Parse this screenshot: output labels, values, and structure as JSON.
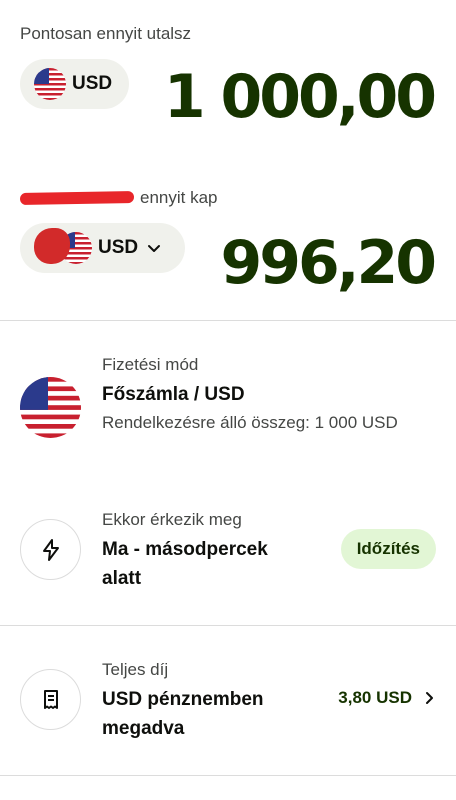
{
  "send": {
    "label": "Pontosan ennyit utalsz",
    "currency": "USD",
    "amount": "1 000,00"
  },
  "receive": {
    "label": "ennyit kap",
    "currency": "USD",
    "amount": "996,20"
  },
  "payment_method": {
    "caption": "Fizetési mód",
    "title": "Főszámla / USD",
    "subtitle": "Rendelkezésre álló összeg: 1 000 USD"
  },
  "arrival": {
    "caption": "Ekkor érkezik meg",
    "title": "Ma - másodpercek alatt",
    "badge": "Időzítés"
  },
  "fee": {
    "caption": "Teljes díj",
    "title": "USD pénznemben megadva",
    "value": "3,80 USD"
  },
  "colors": {
    "amount": "#163300",
    "badge_bg": "#e2f6d5",
    "pill_bg": "#f0f1ec"
  },
  "icons": [
    "us-flag-icon",
    "chevron-down-icon",
    "lightning-icon",
    "receipt-icon",
    "chevron-right-icon"
  ]
}
